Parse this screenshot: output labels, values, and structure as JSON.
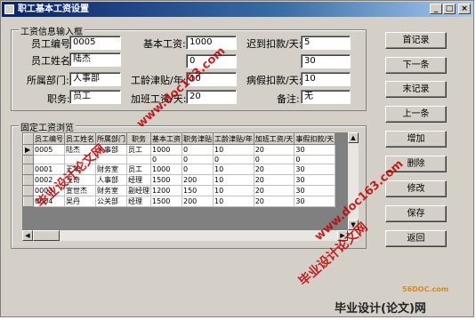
{
  "window": {
    "title": "职工基本工资设置",
    "minimize": "_",
    "maximize": "□",
    "close": "×"
  },
  "input_group": {
    "title": "工资信息输入框",
    "fields": {
      "emp_no": {
        "label": "员工编号:",
        "value": "0005"
      },
      "emp_name": {
        "label": "员工姓名:",
        "value": "陆杰"
      },
      "dept": {
        "label": "所属部门:",
        "value": "人事部"
      },
      "position": {
        "label": "职务:",
        "value": "员工"
      },
      "base_salary": {
        "label": "基本工资:",
        "value": "1000"
      },
      "base_salary_sub": {
        "value": "0"
      },
      "seniority": {
        "label": "工龄津贴/年:",
        "value": "10"
      },
      "overtime": {
        "label": "加班工资/天:",
        "value": "20"
      },
      "late_deduct": {
        "label": "迟到扣款/天:",
        "value": "5"
      },
      "late_sub": {
        "value": "30"
      },
      "sick_deduct": {
        "label": "病假扣款/天:",
        "value": "10"
      },
      "note": {
        "label": "备注:",
        "value": "无"
      }
    }
  },
  "browse_group": {
    "title": "固定工资浏览"
  },
  "table": {
    "columns": [
      "员工编号",
      "员工姓名",
      "所属部门",
      "职务",
      "基本工资",
      "职务津贴",
      "工龄津贴/年",
      "加班工资/天",
      "事假扣款/天"
    ],
    "rows": [
      [
        "0005",
        "陆杰",
        "人事部",
        "员工",
        "1000",
        "0",
        "10",
        "20",
        "30"
      ],
      [
        "",
        "",
        "",
        "",
        "0",
        "0",
        "0",
        "0",
        "0"
      ],
      [
        "0001",
        "王华",
        "财务室",
        "员工",
        "1000",
        "0",
        "10",
        "20",
        "30"
      ],
      [
        "0002",
        "王奇",
        "人事部",
        "经理",
        "1500",
        "200",
        "10",
        "20",
        "30"
      ],
      [
        "0003",
        "宣世杰",
        "财务室",
        "副经理",
        "1200",
        "150",
        "10",
        "20",
        "30"
      ],
      [
        "0004",
        "吴丹",
        "公关部",
        "经理",
        "1500",
        "200",
        "10",
        "20",
        "30"
      ]
    ],
    "current_row_marker": "▶"
  },
  "buttons": [
    "首记录",
    "下一条",
    "末记录",
    "上一条",
    "增加",
    "删除",
    "修改",
    "保存",
    "返回"
  ],
  "watermarks": {
    "site1": "www.doc163.com",
    "brand1": "毕业设计论文网",
    "site2": "www.doc163.com",
    "brand2": "毕业设计论文网",
    "corner_brand": "毕业设计(论文)网",
    "corner_site": "56DOC.com"
  },
  "colors": {
    "title_start": "#0a246a",
    "title_end": "#a6caf0",
    "face": "#d4d0c8",
    "watermark": "#c00000"
  }
}
